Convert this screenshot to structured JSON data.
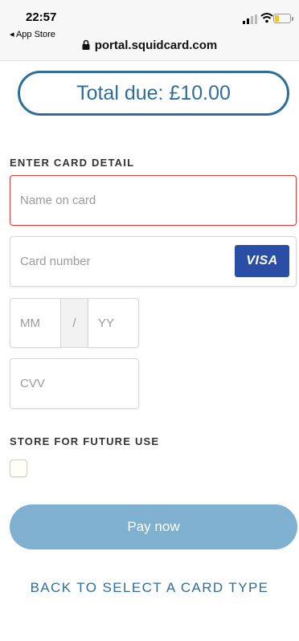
{
  "status_bar": {
    "time": "22:57",
    "back_app": "◂ App Store",
    "url": "portal.squidcard.com"
  },
  "total_due": "Total due: £10.00",
  "card_section": {
    "label": "ENTER CARD DETAIL",
    "name_placeholder": "Name on card",
    "number_placeholder": "Card number",
    "card_brand": "VISA",
    "month_placeholder": "MM",
    "separator": "/",
    "year_placeholder": "YY",
    "cvv_placeholder": "CVV"
  },
  "store_section": {
    "label": "STORE FOR FUTURE USE",
    "checked": false
  },
  "pay_button_label": "Pay now",
  "back_link_label": "BACK TO SELECT A CARD TYPE",
  "colors": {
    "accent": "#2d6f99",
    "pay_button": "#7fb0cf",
    "error_border": "#d83a3a",
    "visa_blue": "#2a4ea6"
  },
  "icons": [
    "signal-icon",
    "wifi-icon",
    "battery-icon",
    "lock-icon"
  ]
}
